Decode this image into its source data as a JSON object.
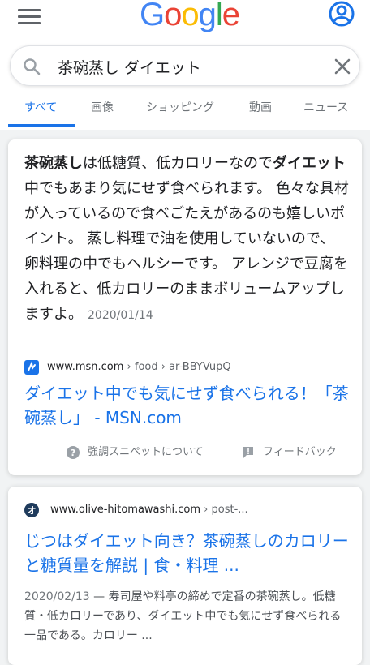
{
  "header": {
    "logo_letters": [
      "G",
      "o",
      "o",
      "g",
      "l",
      "e"
    ],
    "logo_colors": [
      "#4285f4",
      "#ea4335",
      "#fbbc05",
      "#4285f4",
      "#34a853",
      "#ea4335"
    ],
    "menu_icon": "hamburger-menu-icon",
    "account_icon": "account-circle-icon"
  },
  "search": {
    "value": "茶碗蒸し ダイエット",
    "icon": "search-icon",
    "clear_icon": "close-icon"
  },
  "tabs": [
    {
      "label": "すべて",
      "active": true
    },
    {
      "label": "画像",
      "active": false
    },
    {
      "label": "ショッピング",
      "active": false
    },
    {
      "label": "動画",
      "active": false
    },
    {
      "label": "ニュース",
      "active": false
    }
  ],
  "featured_snippet": {
    "text_bold_1": "茶碗蒸し",
    "text_1": "は低糖質、低カロリーなので",
    "text_bold_2": "ダイエット",
    "text_2": "中でもあまり気にせず食べられます。 色々な具材が入っているので食べごたえがあるのも嬉しいポイント。 蒸し料理で油を使用していないので、卵料理の中でもヘルシーです。 アレンジで豆腐を入れると、低カロリーのままボリュームアップしますよ。",
    "date": "2020/01/14",
    "source_domain": "www.msn.com",
    "source_path": " › food › ar-BBYVupQ",
    "title": "ダイエット中でも気にせず食べられる！「茶碗蒸し」 - MSN.com",
    "about_label": "強調スニペットについて",
    "feedback_label": "フィードバック",
    "accent_color": "#1a73e8"
  },
  "result2": {
    "source_domain": "www.olive-hitomawashi.com",
    "source_path": " › post-...",
    "title": "じつはダイエット向き？茶碗蒸しのカロリーと糖質量を解説 | 食・料理 ...",
    "date": "2020/02/13",
    "desc": " — 寿司屋や料亭の締めで定番の茶碗蒸し。低糖質・低カロリーであり、ダイエット中でも気にせず食べられる一品である。カロリー ..."
  }
}
